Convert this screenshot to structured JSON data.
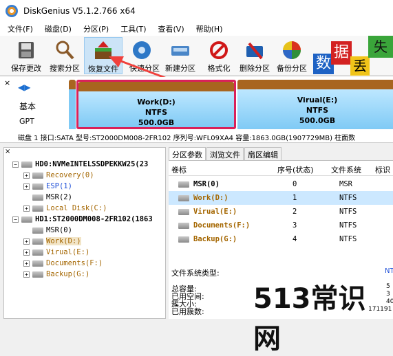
{
  "window": {
    "title": "DiskGenius V5.1.2.766 x64"
  },
  "menu": [
    "文件(F)",
    "磁盘(D)",
    "分区(P)",
    "工具(T)",
    "查看(V)",
    "帮助(H)"
  ],
  "toolbar": [
    {
      "label": "保存更改",
      "icon": "save-icon"
    },
    {
      "label": "搜索分区",
      "icon": "search-icon"
    },
    {
      "label": "恢复文件",
      "icon": "recover-icon"
    },
    {
      "label": "快速分区",
      "icon": "quick-partition-icon"
    },
    {
      "label": "新建分区",
      "icon": "new-partition-icon"
    },
    {
      "label": "格式化",
      "icon": "format-icon"
    },
    {
      "label": "删除分区",
      "icon": "delete-icon"
    },
    {
      "label": "备份分区",
      "icon": "backup-icon"
    }
  ],
  "decor": {
    "chars": [
      "数",
      "据",
      "丢",
      "失"
    ]
  },
  "diskmap": {
    "nav_left": "◀",
    "nav_right": "▶",
    "type": "基本",
    "style": "GPT",
    "close": "×",
    "partitions": [
      {
        "name": "Work(D:)",
        "fs": "NTFS",
        "size": "500.0GB"
      },
      {
        "name": "Virual(E:)",
        "fs": "NTFS",
        "size": "500.0GB"
      }
    ],
    "info": "磁盘 1 接口:SATA  型号:ST2000DM008-2FR102  序列号:WFL09XA4  容量:1863.0GB(1907729MB)  柱面数"
  },
  "tree": [
    {
      "label": "HD0:NVMeINTELSSDPEKKW25(23",
      "level": 0,
      "exp": "−",
      "color": "#000000",
      "bold": true
    },
    {
      "label": "Recovery(0)",
      "level": 1,
      "exp": "+",
      "color": "#a46600"
    },
    {
      "label": "ESP(1)",
      "level": 1,
      "exp": "+",
      "color": "#1e4fd8"
    },
    {
      "label": "MSR(2)",
      "level": 1,
      "exp": "",
      "color": "#000000"
    },
    {
      "label": "Local Disk(C:)",
      "level": 1,
      "exp": "+",
      "color": "#a46600"
    },
    {
      "label": "HD1:ST2000DM008-2FR102(1863",
      "level": 0,
      "exp": "−",
      "color": "#000000",
      "bold": true
    },
    {
      "label": "MSR(0)",
      "level": 1,
      "exp": "",
      "color": "#000000"
    },
    {
      "label": "Work(D:)",
      "level": 1,
      "exp": "+",
      "color": "#a46600",
      "highlight": true
    },
    {
      "label": "Virual(E:)",
      "level": 1,
      "exp": "+",
      "color": "#a46600"
    },
    {
      "label": "Documents(F:)",
      "level": 1,
      "exp": "+",
      "color": "#a46600"
    },
    {
      "label": "Backup(G:)",
      "level": 1,
      "exp": "+",
      "color": "#a46600"
    }
  ],
  "tabs": [
    "分区参数",
    "浏览文件",
    "扇区编辑"
  ],
  "table": {
    "headers": [
      "卷标",
      "序号(状态)",
      "文件系统",
      "标识"
    ],
    "rows": [
      {
        "label": "MSR(0)",
        "num": "0",
        "fs": "MSR",
        "color": "#000000"
      },
      {
        "label": "Work(D:)",
        "num": "1",
        "fs": "NTFS",
        "color": "#a46600",
        "selected": true
      },
      {
        "label": "Virual(E:)",
        "num": "2",
        "fs": "NTFS",
        "color": "#a46600"
      },
      {
        "label": "Documents(F:)",
        "num": "3",
        "fs": "NTFS",
        "color": "#a46600"
      },
      {
        "label": "Backup(G:)",
        "num": "4",
        "fs": "NTFS",
        "color": "#a46600"
      }
    ]
  },
  "props": {
    "fs_label": "文件系统类型:",
    "fs_value": "NT",
    "rows": [
      {
        "label": "总容量:",
        "value": "5"
      },
      {
        "label": "已用空间:",
        "value": "3"
      },
      {
        "label": "簇大小:",
        "value": "40"
      },
      {
        "label": "已用簇数:",
        "value": "171191"
      }
    ]
  },
  "watermark": "513常识网"
}
